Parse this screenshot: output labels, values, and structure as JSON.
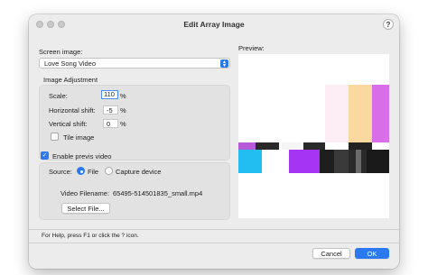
{
  "window": {
    "title": "Edit Array Image"
  },
  "screen_image": {
    "label": "Screen image:",
    "selected": "Love Song Video"
  },
  "preview": {
    "label": "Preview:"
  },
  "image_adjustment": {
    "heading": "Image Adjustment",
    "scale_label": "Scale:",
    "scale_value": "110",
    "scale_unit": "%",
    "hshift_label": "Horizontal shift:",
    "hshift_value": "-5",
    "hshift_unit": "%",
    "vshift_label": "Vertical shift:",
    "vshift_value": "0",
    "vshift_unit": "%",
    "tile_label": "Tile image",
    "tile_checked": false
  },
  "previs": {
    "enable_label": "Enable previs video",
    "enabled": true,
    "source_label": "Source:",
    "source_file_label": "File",
    "source_capture_label": "Capture device",
    "selected_source": "File",
    "filename_label": "Video Filename:",
    "filename_value": "65495-514501835_small.mp4",
    "select_file_label": "Select File..."
  },
  "help_text": "For Help, press F1 or click the ? icon.",
  "help_icon": "?",
  "buttons": {
    "cancel": "Cancel",
    "ok": "OK"
  },
  "colors": {
    "accent": "#2b79f0",
    "preview_pink": "#fdeef5",
    "preview_orange": "#fad9a0",
    "preview_magenta": "#d86ee8",
    "preview_purple": "#a535f2",
    "preview_cyan": "#22bdf1",
    "preview_dark": "#2a2a2a"
  }
}
